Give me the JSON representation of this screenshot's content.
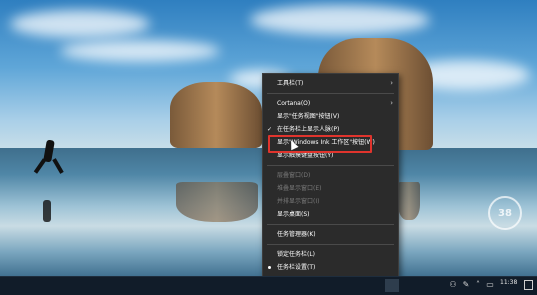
{
  "context_menu": {
    "items": [
      {
        "label": "工具栏(T)",
        "has_submenu": true
      },
      {
        "label": "Cortana(O)",
        "has_submenu": true
      },
      {
        "label": "显示\"任务视图\"按钮(V)"
      },
      {
        "label": "在任务栏上显示人脉(P)",
        "checked": true
      },
      {
        "label": "显示\"Windows Ink 工作区\"按钮(W)",
        "highlighted": true
      },
      {
        "label": "显示触摸键盘按钮(Y)"
      },
      {
        "label": "层叠窗口(D)",
        "disabled": true
      },
      {
        "label": "堆叠显示窗口(E)",
        "disabled": true
      },
      {
        "label": "并排显示窗口(I)",
        "disabled": true
      },
      {
        "label": "显示桌面(S)"
      },
      {
        "label": "任务管理器(K)"
      },
      {
        "label": "锁定任务栏(L)"
      },
      {
        "label": "任务栏设置(T)",
        "radio": true
      }
    ]
  },
  "taskbar": {
    "time": "11:38"
  },
  "watermark": {
    "text": "3"
  },
  "colors": {
    "menu_bg": "#2b2b2b",
    "highlight_border": "#e0342d"
  }
}
